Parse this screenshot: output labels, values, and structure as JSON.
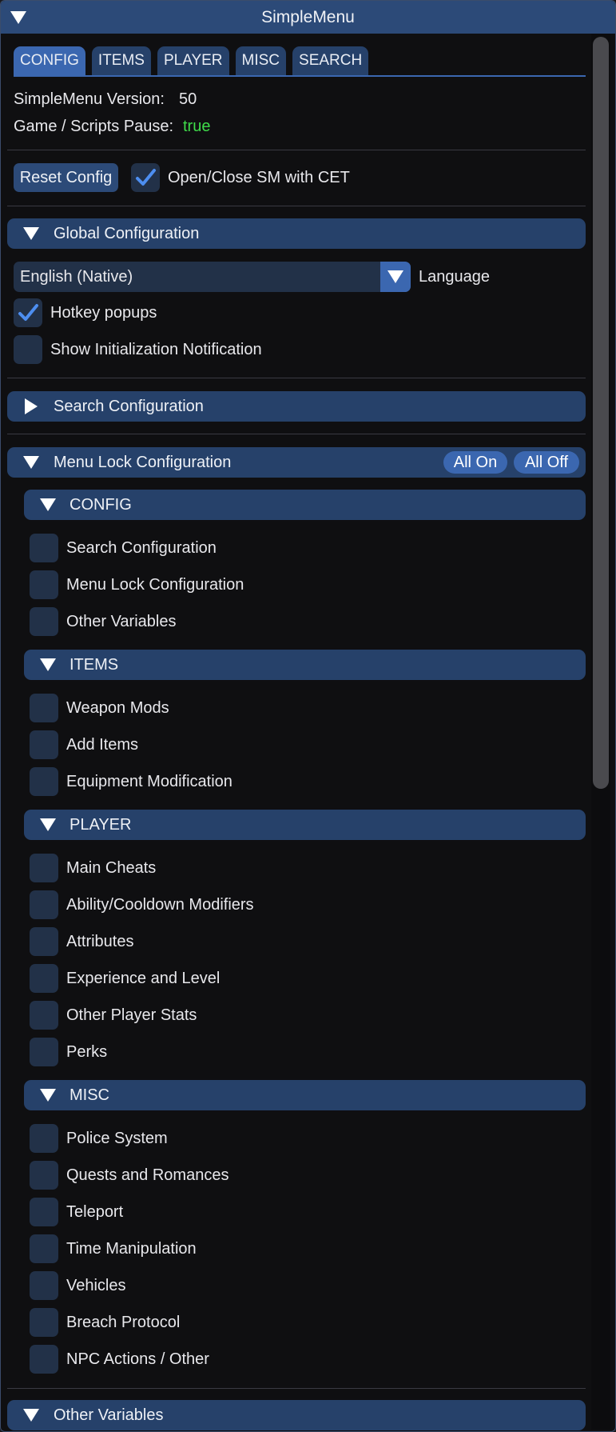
{
  "window": {
    "title": "SimpleMenu"
  },
  "tabs": [
    "CONFIG",
    "ITEMS",
    "PLAYER",
    "MISC",
    "SEARCH"
  ],
  "info": {
    "version_label": "SimpleMenu Version:",
    "version_value": "50",
    "pause_label": "Game / Scripts Pause:",
    "pause_value": "true"
  },
  "toolbar": {
    "reset_label": "Reset Config",
    "open_close_label": "Open/Close SM with CET",
    "open_close_checked": true
  },
  "global": {
    "header": "Global Configuration",
    "language_value": "English (Native)",
    "language_label": "Language",
    "hotkey_label": "Hotkey popups",
    "hotkey_checked": true,
    "init_label": "Show Initialization Notification",
    "init_checked": false
  },
  "search": {
    "header": "Search Configuration"
  },
  "menulock": {
    "header": "Menu Lock Configuration",
    "all_on": "All On",
    "all_off": "All Off",
    "groups": [
      {
        "name": "CONFIG",
        "items": [
          "Search Configuration",
          "Menu Lock Configuration",
          "Other Variables"
        ]
      },
      {
        "name": "ITEMS",
        "items": [
          "Weapon Mods",
          "Add Items",
          "Equipment Modification"
        ]
      },
      {
        "name": "PLAYER",
        "items": [
          "Main Cheats",
          "Ability/Cooldown Modifiers",
          "Attributes",
          "Experience and Level",
          "Other Player Stats",
          "Perks"
        ]
      },
      {
        "name": "MISC",
        "items": [
          "Police System",
          "Quests and Romances",
          "Teleport",
          "Time Manipulation",
          "Vehicles",
          "Breach Protocol",
          "NPC Actions / Other"
        ]
      }
    ]
  },
  "other": {
    "header": "Other Variables"
  },
  "colors": {
    "accent": "#3b67b0",
    "header_bg": "#26416a",
    "checkbox_bg": "#223148",
    "true_value": "#3fdc4a"
  }
}
